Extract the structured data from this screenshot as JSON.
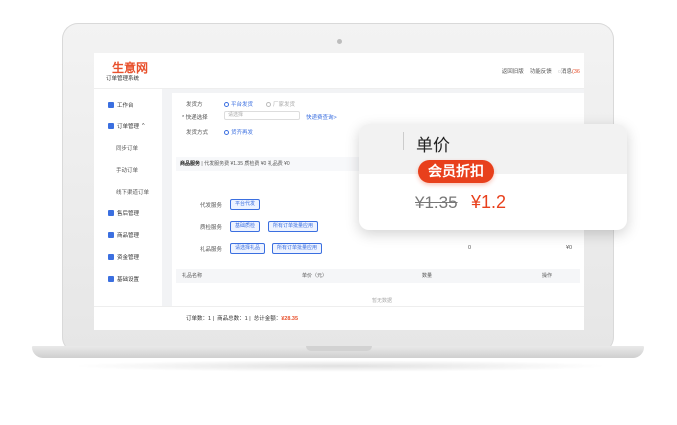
{
  "app": {
    "logo": "生意网",
    "subtitle": "订单管理系统"
  },
  "header": {
    "link1": "返回旧版",
    "link2": "功能反馈",
    "link3": "消息",
    "msg_count": "(36"
  },
  "sidebar": {
    "items": [
      {
        "label": "工作台",
        "icon": "home-icon"
      },
      {
        "label": "订单管理",
        "icon": "order-icon"
      },
      {
        "label": "售后管理",
        "icon": "aftersale-icon"
      },
      {
        "label": "商品管理",
        "icon": "goods-icon"
      },
      {
        "label": "资金管理",
        "icon": "money-icon"
      },
      {
        "label": "基础设置",
        "icon": "gear-icon"
      }
    ],
    "subitems": [
      "同步订单",
      "手动订单",
      "线下渠道订单"
    ]
  },
  "form": {
    "ship_label": "发货方",
    "ship_opt1": "平台发货",
    "ship_opt2": "厂家发货",
    "express_label": "* 快递选择",
    "express_placeholder": "请选择",
    "express_link": "快递费查询>",
    "method_label": "发货方式",
    "method_opt": "货齐再发"
  },
  "tabs": {
    "active": "商品服务",
    "rest": "代发服务费 ¥1.35  质检费 ¥0  礼品费 ¥0"
  },
  "services": {
    "row1_label": "代发服务",
    "row1_btn": "平台代发",
    "row2_label": "质检服务",
    "row2_btn1": "基础质检",
    "row2_btn2": "所有订单批量应用",
    "row3_label": "礼品服务",
    "row3_btn1": "请选择礼品",
    "row3_btn2": "所有订单批量应用",
    "val_zero": "0",
    "val_price": "¥0"
  },
  "table": {
    "headers": [
      "礼品名称",
      "单价（元）",
      "数量",
      "操作"
    ],
    "empty": "暂无数据"
  },
  "footer": {
    "orders_label": "订单数：",
    "orders": "1",
    "goods_label": "商品总数：",
    "goods": "1",
    "total_label": "总计金额：",
    "total": "¥28.35"
  },
  "popup": {
    "title": "单价",
    "badge": "会员折扣",
    "old_price": "¥1.35",
    "new_price": "¥1.2"
  },
  "colors": {
    "accent": "#3b6fe0",
    "brand": "#e8512d",
    "discount": "#e8401c"
  }
}
